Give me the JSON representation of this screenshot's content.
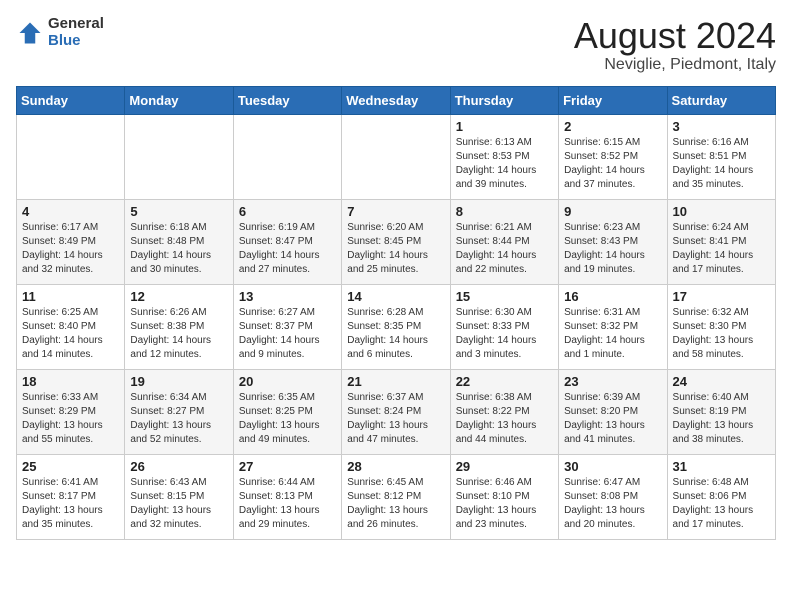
{
  "logo": {
    "general": "General",
    "blue": "Blue"
  },
  "title": {
    "month_year": "August 2024",
    "location": "Neviglie, Piedmont, Italy"
  },
  "days_of_week": [
    "Sunday",
    "Monday",
    "Tuesday",
    "Wednesday",
    "Thursday",
    "Friday",
    "Saturday"
  ],
  "weeks": [
    [
      {
        "day": "",
        "info": ""
      },
      {
        "day": "",
        "info": ""
      },
      {
        "day": "",
        "info": ""
      },
      {
        "day": "",
        "info": ""
      },
      {
        "day": "1",
        "info": "Sunrise: 6:13 AM\nSunset: 8:53 PM\nDaylight: 14 hours\nand 39 minutes."
      },
      {
        "day": "2",
        "info": "Sunrise: 6:15 AM\nSunset: 8:52 PM\nDaylight: 14 hours\nand 37 minutes."
      },
      {
        "day": "3",
        "info": "Sunrise: 6:16 AM\nSunset: 8:51 PM\nDaylight: 14 hours\nand 35 minutes."
      }
    ],
    [
      {
        "day": "4",
        "info": "Sunrise: 6:17 AM\nSunset: 8:49 PM\nDaylight: 14 hours\nand 32 minutes."
      },
      {
        "day": "5",
        "info": "Sunrise: 6:18 AM\nSunset: 8:48 PM\nDaylight: 14 hours\nand 30 minutes."
      },
      {
        "day": "6",
        "info": "Sunrise: 6:19 AM\nSunset: 8:47 PM\nDaylight: 14 hours\nand 27 minutes."
      },
      {
        "day": "7",
        "info": "Sunrise: 6:20 AM\nSunset: 8:45 PM\nDaylight: 14 hours\nand 25 minutes."
      },
      {
        "day": "8",
        "info": "Sunrise: 6:21 AM\nSunset: 8:44 PM\nDaylight: 14 hours\nand 22 minutes."
      },
      {
        "day": "9",
        "info": "Sunrise: 6:23 AM\nSunset: 8:43 PM\nDaylight: 14 hours\nand 19 minutes."
      },
      {
        "day": "10",
        "info": "Sunrise: 6:24 AM\nSunset: 8:41 PM\nDaylight: 14 hours\nand 17 minutes."
      }
    ],
    [
      {
        "day": "11",
        "info": "Sunrise: 6:25 AM\nSunset: 8:40 PM\nDaylight: 14 hours\nand 14 minutes."
      },
      {
        "day": "12",
        "info": "Sunrise: 6:26 AM\nSunset: 8:38 PM\nDaylight: 14 hours\nand 12 minutes."
      },
      {
        "day": "13",
        "info": "Sunrise: 6:27 AM\nSunset: 8:37 PM\nDaylight: 14 hours\nand 9 minutes."
      },
      {
        "day": "14",
        "info": "Sunrise: 6:28 AM\nSunset: 8:35 PM\nDaylight: 14 hours\nand 6 minutes."
      },
      {
        "day": "15",
        "info": "Sunrise: 6:30 AM\nSunset: 8:33 PM\nDaylight: 14 hours\nand 3 minutes."
      },
      {
        "day": "16",
        "info": "Sunrise: 6:31 AM\nSunset: 8:32 PM\nDaylight: 14 hours\nand 1 minute."
      },
      {
        "day": "17",
        "info": "Sunrise: 6:32 AM\nSunset: 8:30 PM\nDaylight: 13 hours\nand 58 minutes."
      }
    ],
    [
      {
        "day": "18",
        "info": "Sunrise: 6:33 AM\nSunset: 8:29 PM\nDaylight: 13 hours\nand 55 minutes."
      },
      {
        "day": "19",
        "info": "Sunrise: 6:34 AM\nSunset: 8:27 PM\nDaylight: 13 hours\nand 52 minutes."
      },
      {
        "day": "20",
        "info": "Sunrise: 6:35 AM\nSunset: 8:25 PM\nDaylight: 13 hours\nand 49 minutes."
      },
      {
        "day": "21",
        "info": "Sunrise: 6:37 AM\nSunset: 8:24 PM\nDaylight: 13 hours\nand 47 minutes."
      },
      {
        "day": "22",
        "info": "Sunrise: 6:38 AM\nSunset: 8:22 PM\nDaylight: 13 hours\nand 44 minutes."
      },
      {
        "day": "23",
        "info": "Sunrise: 6:39 AM\nSunset: 8:20 PM\nDaylight: 13 hours\nand 41 minutes."
      },
      {
        "day": "24",
        "info": "Sunrise: 6:40 AM\nSunset: 8:19 PM\nDaylight: 13 hours\nand 38 minutes."
      }
    ],
    [
      {
        "day": "25",
        "info": "Sunrise: 6:41 AM\nSunset: 8:17 PM\nDaylight: 13 hours\nand 35 minutes."
      },
      {
        "day": "26",
        "info": "Sunrise: 6:43 AM\nSunset: 8:15 PM\nDaylight: 13 hours\nand 32 minutes."
      },
      {
        "day": "27",
        "info": "Sunrise: 6:44 AM\nSunset: 8:13 PM\nDaylight: 13 hours\nand 29 minutes."
      },
      {
        "day": "28",
        "info": "Sunrise: 6:45 AM\nSunset: 8:12 PM\nDaylight: 13 hours\nand 26 minutes."
      },
      {
        "day": "29",
        "info": "Sunrise: 6:46 AM\nSunset: 8:10 PM\nDaylight: 13 hours\nand 23 minutes."
      },
      {
        "day": "30",
        "info": "Sunrise: 6:47 AM\nSunset: 8:08 PM\nDaylight: 13 hours\nand 20 minutes."
      },
      {
        "day": "31",
        "info": "Sunrise: 6:48 AM\nSunset: 8:06 PM\nDaylight: 13 hours\nand 17 minutes."
      }
    ]
  ]
}
